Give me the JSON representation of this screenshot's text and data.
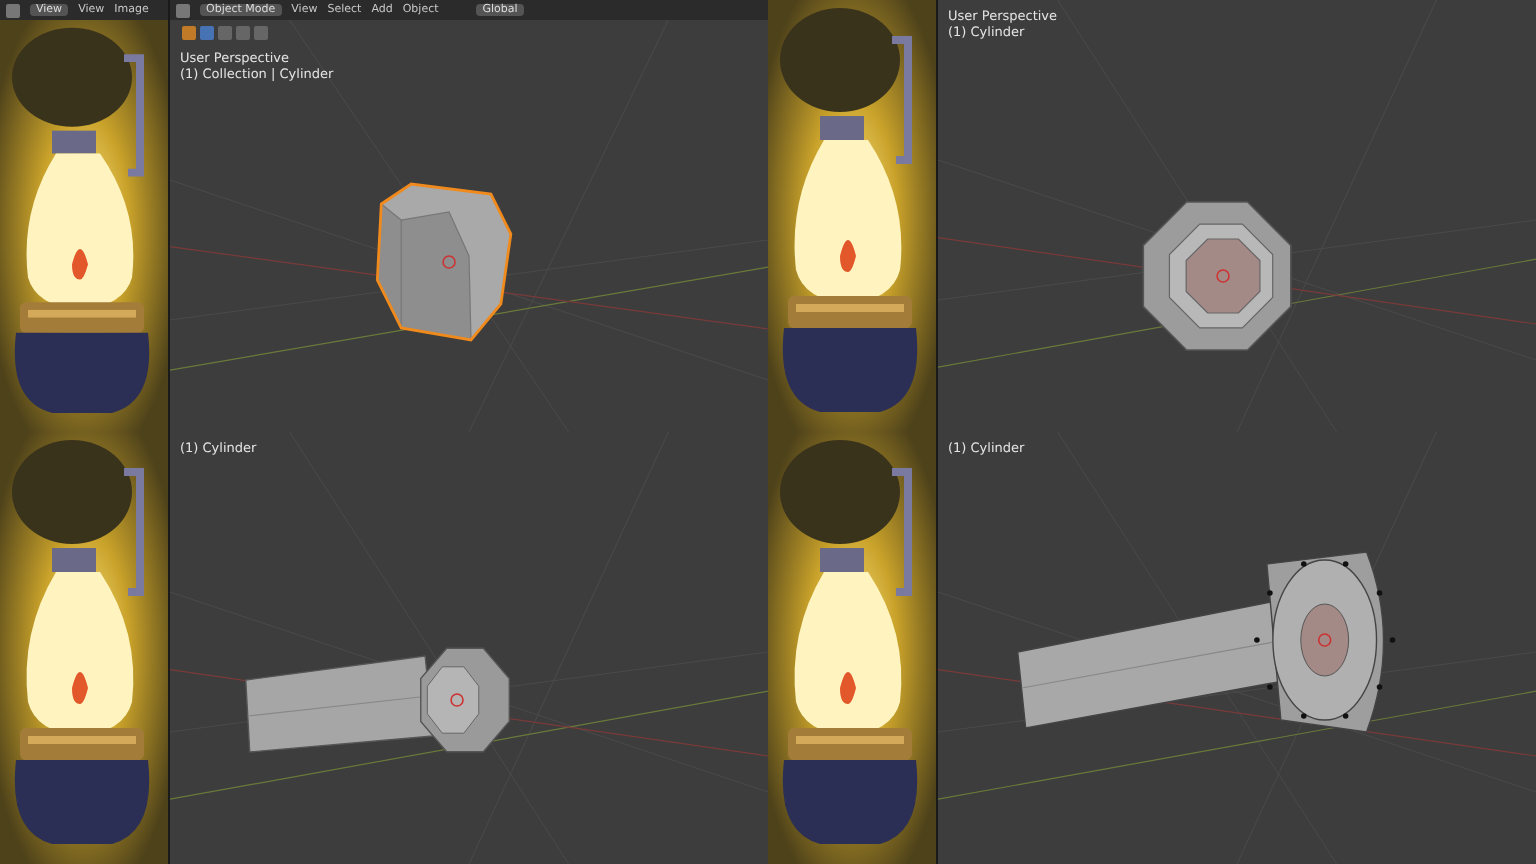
{
  "panels": [
    {
      "image_editor_header": {
        "view_dropdown": "View",
        "menus": [
          "View",
          "Image"
        ]
      },
      "viewport_header": {
        "mode": "Object Mode",
        "menus": [
          "View",
          "Select",
          "Add",
          "Object"
        ],
        "orientation": "Global"
      },
      "overlay": [
        "User Perspective",
        "(1) Collection | Cylinder"
      ],
      "mesh": {
        "kind": "prism",
        "selected": true
      }
    },
    {
      "overlay": [
        "User Perspective",
        "(1) Cylinder"
      ],
      "mesh": {
        "kind": "ring",
        "selected": false
      }
    },
    {
      "overlay": [
        "(1) Cylinder"
      ],
      "mesh": {
        "kind": "short-tube",
        "selected": false
      }
    },
    {
      "overlay": [
        "(1) Cylinder"
      ],
      "mesh": {
        "kind": "long-tube",
        "selected": false
      }
    }
  ]
}
